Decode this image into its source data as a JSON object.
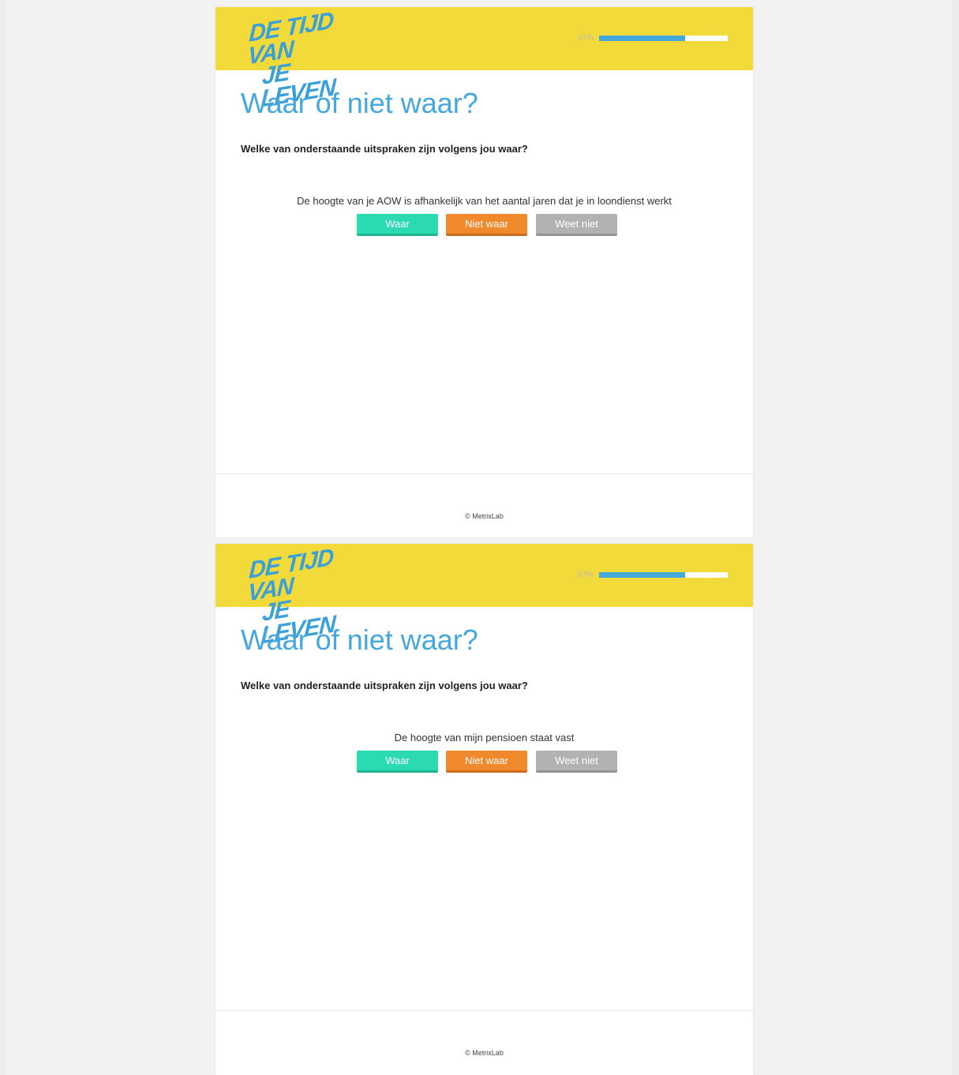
{
  "survey": {
    "logo_line1": "DE TIJD VAN",
    "logo_line2": "JE LEVEN",
    "progress_label": "67%",
    "progress_value": 0.67,
    "title": "Waar of niet waar?",
    "question": "Welke van onderstaande uitspraken zijn volgens jou waar?",
    "buttons": {
      "true_label": "Waar",
      "false_label": "Niet waar",
      "unknown_label": "Weet niet"
    },
    "footer": "© MetrixLab"
  },
  "screens": [
    {
      "statement": "De hoogte van je AOW is afhankelijk van het aantal jaren dat je in loondienst werkt"
    },
    {
      "statement": "De hoogte van mijn pensioen staat vast"
    }
  ],
  "colors": {
    "header_bg": "#f2da3a",
    "logo": "#3aa0d9",
    "title": "#44a8de",
    "progress": "#46a8d9",
    "btn_true": "#2bdab0",
    "btn_false": "#f0892c",
    "btn_unknown": "#b2b2b2"
  }
}
